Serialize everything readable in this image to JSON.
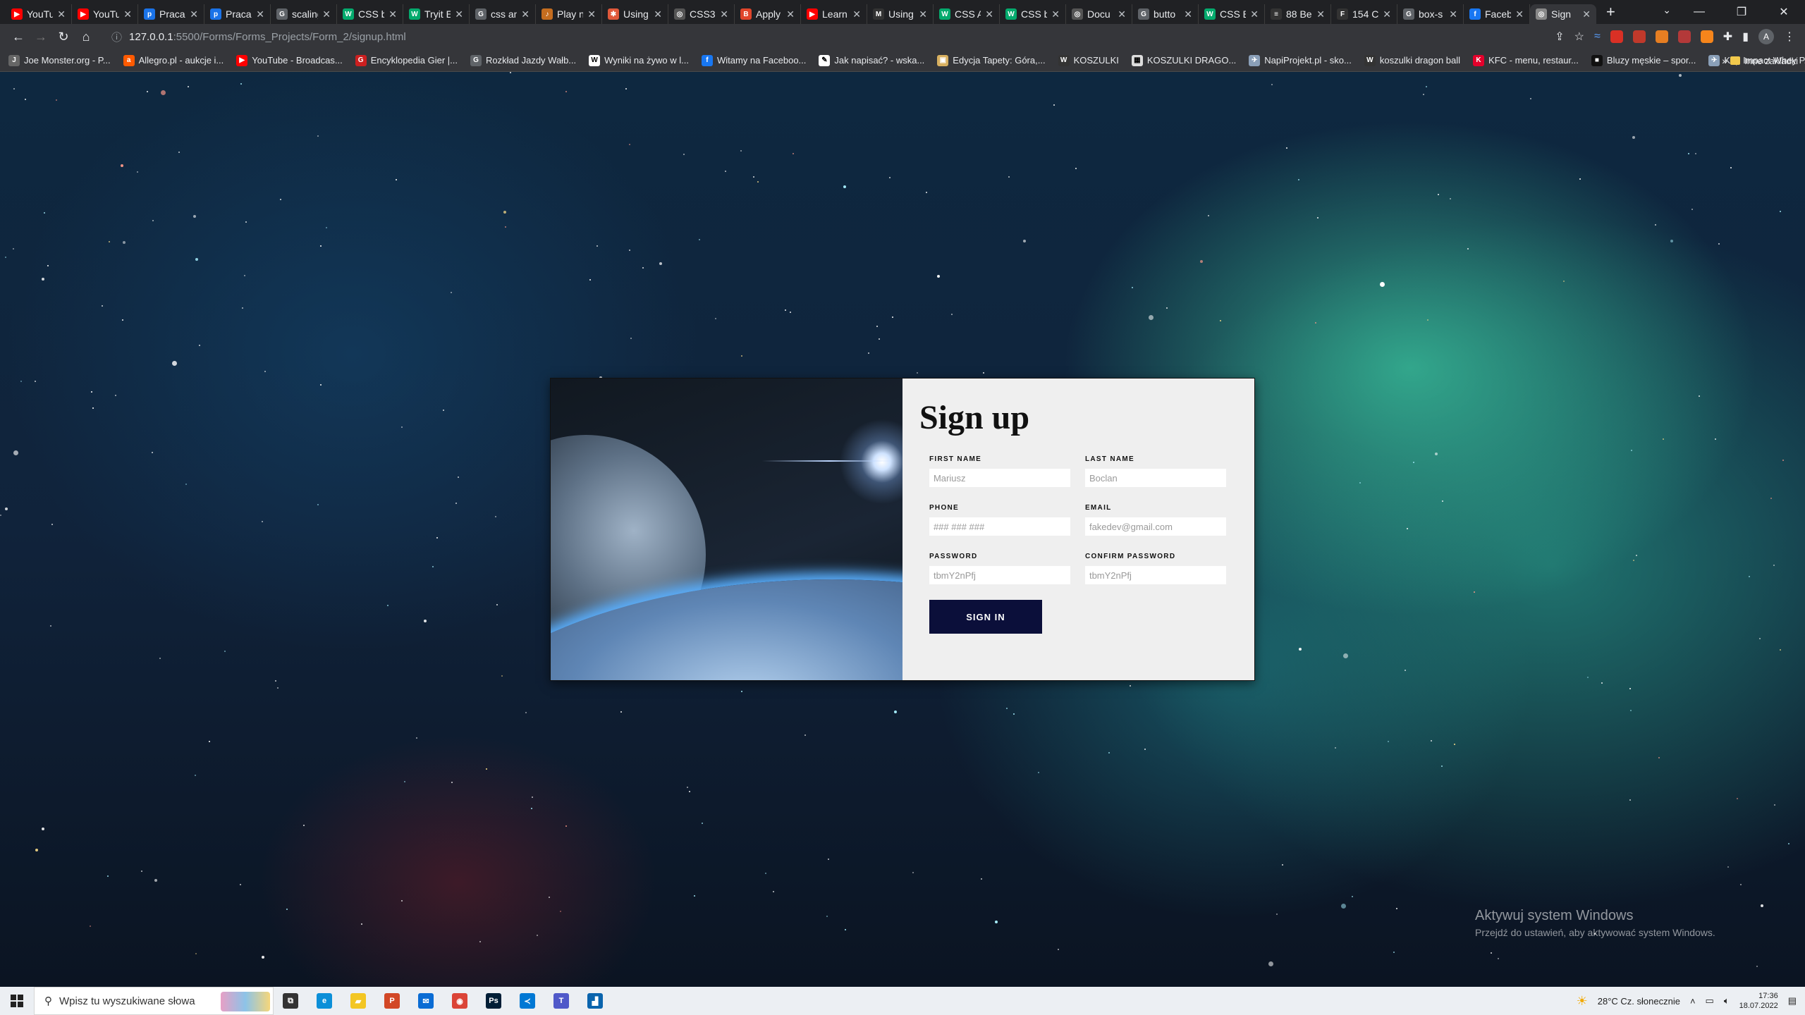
{
  "browser": {
    "tabs": [
      {
        "title": "YouTube",
        "fav": "▶",
        "color": "#ff0000"
      },
      {
        "title": "YouTube",
        "fav": "▶",
        "color": "#ff0000"
      },
      {
        "title": "Praca",
        "fav": "p",
        "color": "#1a73e8"
      },
      {
        "title": "Praca",
        "fav": "p",
        "color": "#1a73e8"
      },
      {
        "title": "scaling",
        "fav": "G",
        "color": "#5f6368"
      },
      {
        "title": "CSS b",
        "fav": "W",
        "color": "#04aa6d"
      },
      {
        "title": "Tryit E",
        "fav": "W",
        "color": "#04aa6d"
      },
      {
        "title": "css an",
        "fav": "G",
        "color": "#5f6368"
      },
      {
        "title": "Play n",
        "fav": "♪",
        "color": "#c56d1f"
      },
      {
        "title": "Using",
        "fav": "✱",
        "color": "#e0593b"
      },
      {
        "title": "CSS3",
        "fav": "◎",
        "color": "#555555"
      },
      {
        "title": "Apply",
        "fav": "B",
        "color": "#e0452b"
      },
      {
        "title": "Learn",
        "fav": "▶",
        "color": "#ff0000"
      },
      {
        "title": "Using",
        "fav": "M",
        "color": "#333333"
      },
      {
        "title": "CSS A",
        "fav": "W",
        "color": "#04aa6d"
      },
      {
        "title": "CSS b",
        "fav": "W",
        "color": "#04aa6d"
      },
      {
        "title": "Docu",
        "fav": "◎",
        "color": "#555555"
      },
      {
        "title": "butto",
        "fav": "G",
        "color": "#5f6368"
      },
      {
        "title": "CSS B",
        "fav": "W",
        "color": "#04aa6d"
      },
      {
        "title": "88 Be",
        "fav": "≡",
        "color": "#333333"
      },
      {
        "title": "154 C",
        "fav": "F",
        "color": "#333333"
      },
      {
        "title": "box-s",
        "fav": "G",
        "color": "#5f6368"
      },
      {
        "title": "Faceb",
        "fav": "f",
        "color": "#1877f2"
      },
      {
        "title": "Sign",
        "fav": "◎",
        "color": "#888888",
        "active": true
      }
    ],
    "address": {
      "host": "127.0.0.1",
      "path": ":5500/Forms/Forms_Projects/Form_2/signup.html"
    },
    "bookmarks": [
      {
        "label": "Joe Monster.org - P...",
        "fav": "J",
        "color": "#666666"
      },
      {
        "label": "Allegro.pl - aukcje i...",
        "fav": "a",
        "color": "#ff5a00"
      },
      {
        "label": "YouTube - Broadcas...",
        "fav": "▶",
        "color": "#ff0000"
      },
      {
        "label": "Encyklopedia Gier |...",
        "fav": "G",
        "color": "#cc1f1f"
      },
      {
        "label": "Rozkład Jazdy Wałb...",
        "fav": "G",
        "color": "#5f6368"
      },
      {
        "label": "Wyniki na żywo w l...",
        "fav": "W",
        "color": "#ffffff"
      },
      {
        "label": "Witamy na Faceboo...",
        "fav": "f",
        "color": "#1877f2"
      },
      {
        "label": "Jak napisać? - wska...",
        "fav": "✎",
        "color": "#ffffff"
      },
      {
        "label": "Edycja Tapety: Góra,...",
        "fav": "▣",
        "color": "#d8b060"
      },
      {
        "label": "KOSZULKI",
        "fav": "W",
        "color": "#333333"
      },
      {
        "label": "KOSZULKI DRAGO...",
        "fav": "▦",
        "color": "#dddddd"
      },
      {
        "label": "NapiProjekt.pl - sko...",
        "fav": "✈",
        "color": "#8a9fb8"
      },
      {
        "label": "koszulki dragon ball",
        "fav": "W",
        "color": "#333333"
      },
      {
        "label": "KFC - menu, restaur...",
        "fav": "K",
        "color": "#e4002b"
      },
      {
        "label": "Bluzy męskie – spor...",
        "fav": "■",
        "color": "#111111"
      },
      {
        "label": "Kup Impact Whey P...",
        "fav": "✈",
        "color": "#8a9fb8"
      }
    ],
    "bookmarks_more": "»",
    "other_bookmarks": "Inne zakładki",
    "avatar_letter": "A"
  },
  "signup": {
    "title": "Sign up",
    "fields": [
      {
        "label": "FIRST NAME",
        "placeholder": "Mariusz",
        "type": "text"
      },
      {
        "label": "LAST NAME",
        "placeholder": "Boclan",
        "type": "text"
      },
      {
        "label": "PHONE",
        "placeholder": "### ### ###",
        "type": "text"
      },
      {
        "label": "EMAIL",
        "placeholder": "fakedev@gmail.com",
        "type": "text"
      },
      {
        "label": "PASSWORD",
        "placeholder": "tbmY2nPfj",
        "type": "text"
      },
      {
        "label": "CONFIRM PASSWORD",
        "placeholder": "tbmY2nPfj",
        "type": "text"
      }
    ],
    "button_label": "SIGN IN",
    "button_color": "#0b0f3a"
  },
  "watermark": {
    "line1": "Aktywuj system Windows",
    "line2": "Przejdź do ustawień, aby aktywować system Windows."
  },
  "taskbar": {
    "search_placeholder": "Wpisz tu wyszukiwane słowa",
    "apps": [
      {
        "name": "task-view-icon",
        "glyph": "⧉",
        "color": "#333333"
      },
      {
        "name": "edge-icon",
        "glyph": "e",
        "color": "#0b8fd8"
      },
      {
        "name": "file-explorer-icon",
        "glyph": "▰",
        "color": "#f3c623"
      },
      {
        "name": "powerpoint-icon",
        "glyph": "P",
        "color": "#d24726"
      },
      {
        "name": "mail-icon",
        "glyph": "✉",
        "color": "#0a6cd4"
      },
      {
        "name": "chrome-icon",
        "glyph": "◉",
        "color": "#db4437"
      },
      {
        "name": "photoshop-icon",
        "glyph": "Ps",
        "color": "#001e36"
      },
      {
        "name": "vscode-icon",
        "glyph": "≺",
        "color": "#0078d4"
      },
      {
        "name": "teams-icon",
        "glyph": "T",
        "color": "#5059c9"
      },
      {
        "name": "photos-icon",
        "glyph": "▟",
        "color": "#0a64ad"
      }
    ],
    "weather": "28°C  Cz. słonecznie",
    "time": "17:36",
    "date": "18.07.2022"
  }
}
